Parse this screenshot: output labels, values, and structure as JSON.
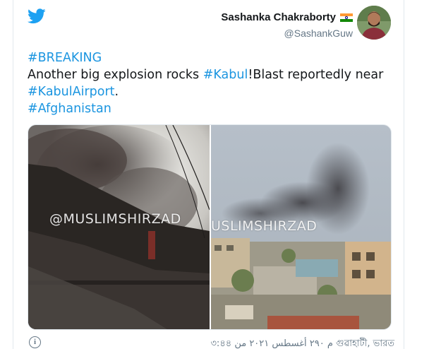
{
  "tweet": {
    "author": {
      "name": "Sashanka Chakraborty",
      "handle": "@SashankGuw"
    },
    "text": {
      "breaking_tag": "#BREAKING",
      "line_prefix": "Another big explosion rocks ",
      "kabul_tag": "#Kabul",
      "line_suffix": "!Blast reportedly near",
      "airport_tag": "#KabulAirport",
      "period": ".",
      "afghanistan_tag": "#Afghanistan"
    },
    "media": {
      "left_watermark": "@MUSLIMSHIRZAD",
      "right_watermark": "USLIMSHIRZAD"
    },
    "footer": {
      "info_icon_glyph": "i",
      "timestamp": "৩:৪৪ م ٢٩٠ أغسطس ٢٠٢١ من গুৱাহাটী, ভারত"
    }
  },
  "colors": {
    "twitter_blue": "#1da1f2",
    "link_blue": "#1b95e0",
    "text_primary": "#14171a",
    "text_secondary": "#657786"
  },
  "icons": {
    "logo": "twitter-bird-icon",
    "flag": "india-flag-icon",
    "info": "info-icon"
  }
}
